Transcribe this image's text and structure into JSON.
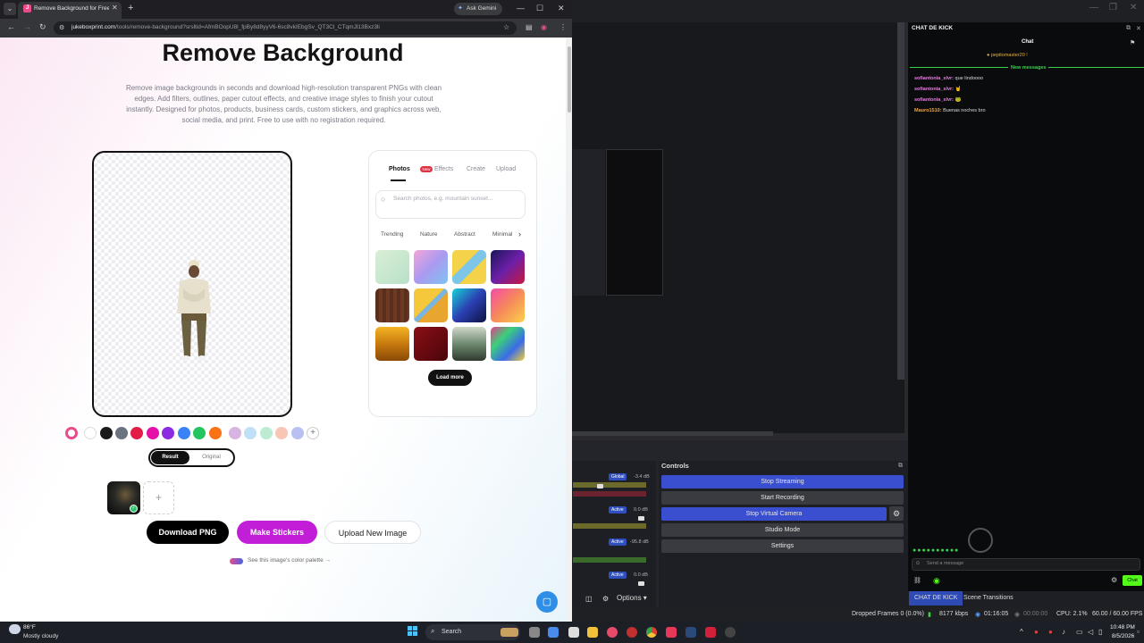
{
  "browser": {
    "tab_title": "Remove Background for Free | Juk",
    "tab_favicon_letter": "J",
    "gemini_label": "Ask Gemini",
    "url_domain": "jukeboxprint.com",
    "url_path": "/tools/remove-background?srsltid=AfmBOopU8l_fpBy8d8yyV6-6sc8vkIEbgSv_QT3Cl_CTqmJl13Bxz3li"
  },
  "page": {
    "title": "Remove Background",
    "description": "Remove image backgrounds in seconds and download high-resolution transparent PNGs with clean edges. Add filters, outlines, paper cutout effects, and creative image styles to finish your cutout instantly. Designed for photos, products, business cards, custom stickers, and graphics across web, social media, and print. Free to use with no registration required.",
    "panel_tabs": [
      "Photos",
      "Effects",
      "Create",
      "Upload"
    ],
    "new_badge": "New",
    "search_placeholder": "Search photos, e.g. mountain sunset...",
    "categories": [
      "Trending",
      "Nature",
      "Abstract",
      "Minimal"
    ],
    "load_more": "Load more",
    "swatch_colors": [
      "#ffffff",
      "#1a1a1a",
      "#6b7280",
      "#e11d48",
      "#e60fa8",
      "#8b2be2",
      "#3b82f6",
      "#22c55e",
      "#f97316",
      "#d8b4e2",
      "#bfe0f5",
      "#bcecd1",
      "#f9c5b5",
      "#b8c1f2"
    ],
    "toggle_result": "Result",
    "toggle_original": "Original",
    "btn_download": "Download PNG",
    "btn_stickers": "Make Stickers",
    "btn_upload": "Upload New Image",
    "palette_link": "See this image's color palette →"
  },
  "obs": {
    "controls_title": "Controls",
    "controls": [
      "Stop Streaming",
      "Start Recording",
      "Stop Virtual Camera",
      "Studio Mode",
      "Settings"
    ],
    "mixer": {
      "global_badge": "Global",
      "active_badge": "Active",
      "values": [
        "-3.4 dB",
        "0.0 dB",
        "-95.8 dB",
        "0.0 dB"
      ],
      "options_label": "Options"
    },
    "status": {
      "dropped": "Dropped Frames 0 (0.0%)",
      "bitrate": "8177 kbps",
      "live_time": "01:16:05",
      "rec_time": "00:00:00",
      "cpu": "CPU: 2.1%",
      "fps": "60.00 / 60.00 FPS"
    }
  },
  "chat": {
    "panel_title": "CHAT DE KICK",
    "header": "Chat",
    "pinned": "pepitomaster20 !",
    "new_messages": "New messages",
    "messages": [
      {
        "user": "sofiantonia_slvr:",
        "text": "que lindoooo"
      },
      {
        "user": "sofiantonia_slvr:",
        "text": ""
      },
      {
        "user": "sofiantonia_slvr:",
        "text": ""
      },
      {
        "user": "Mauro1510:",
        "text": "Buenas noches bro"
      }
    ],
    "input_placeholder": "Send a message",
    "send_label": "Chat",
    "tabs": [
      "CHAT DE KICK",
      "Scene Transitions"
    ]
  },
  "taskbar": {
    "temperature": "86°F",
    "weather": "Mostly cloudy",
    "search": "Search",
    "time": "10:48 PM",
    "date": "8/5/2026"
  }
}
